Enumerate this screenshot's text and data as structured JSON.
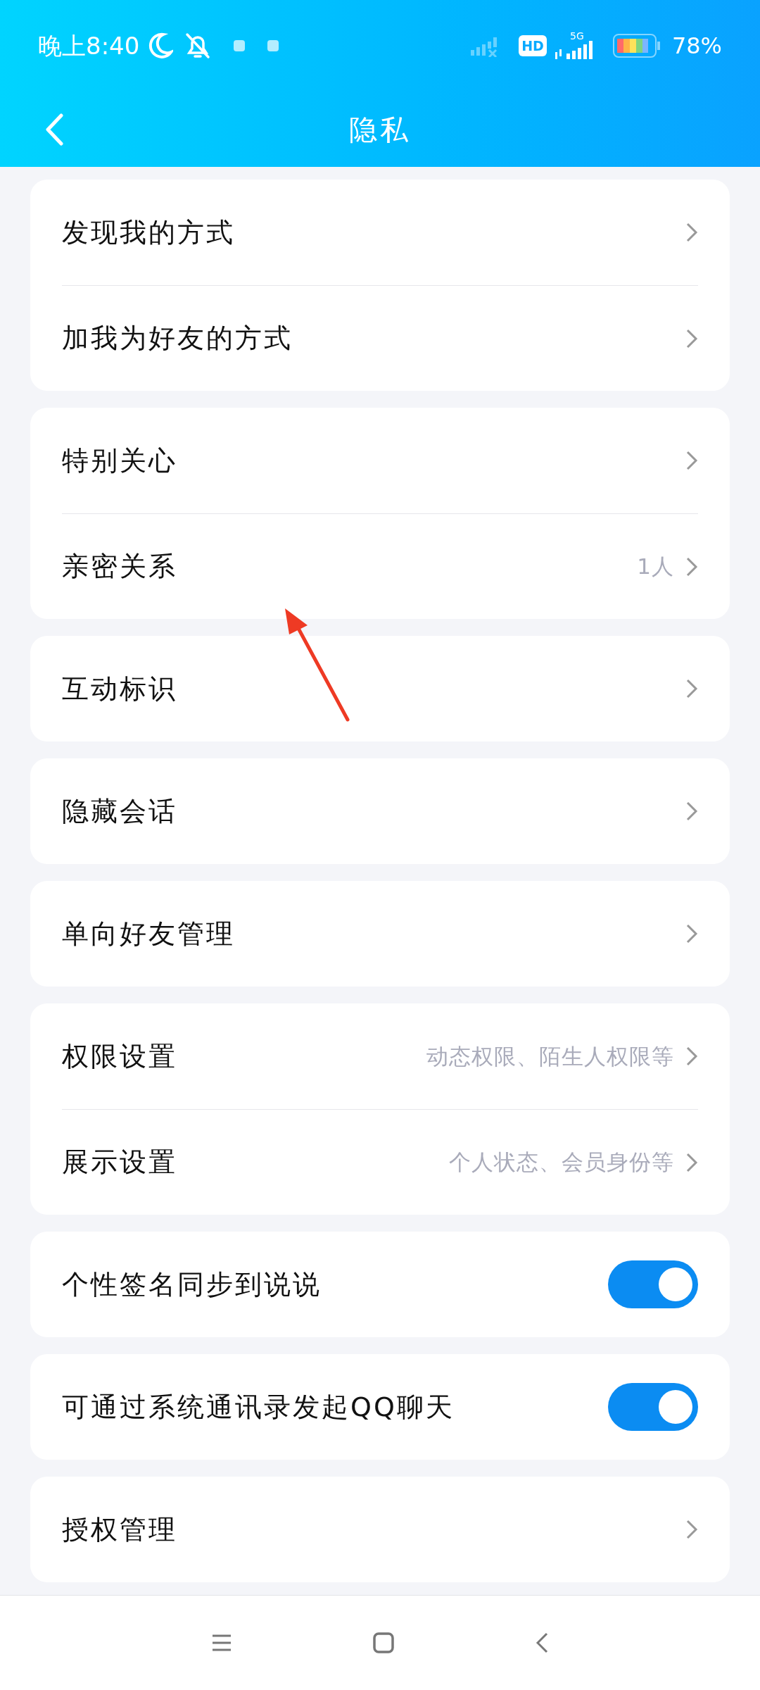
{
  "status_bar": {
    "time": "晚上8:40",
    "hd_badge": "HD",
    "network": "5G",
    "battery": "78%"
  },
  "header": {
    "title": "隐私"
  },
  "groups": [
    {
      "rows": [
        {
          "kind": "link",
          "label": "发现我的方式"
        },
        {
          "kind": "link",
          "label": "加我为好友的方式"
        }
      ]
    },
    {
      "rows": [
        {
          "kind": "link",
          "label": "特别关心"
        },
        {
          "kind": "link",
          "label": "亲密关系",
          "value": "1人"
        }
      ]
    },
    {
      "rows": [
        {
          "kind": "link",
          "label": "互动标识"
        }
      ]
    },
    {
      "rows": [
        {
          "kind": "link",
          "label": "隐藏会话"
        }
      ]
    },
    {
      "rows": [
        {
          "kind": "link",
          "label": "单向好友管理"
        }
      ]
    },
    {
      "rows": [
        {
          "kind": "link",
          "label": "权限设置",
          "value": "动态权限、陌生人权限等"
        },
        {
          "kind": "link",
          "label": "展示设置",
          "value": "个人状态、会员身份等"
        }
      ]
    },
    {
      "rows": [
        {
          "kind": "toggle",
          "label": "个性签名同步到说说",
          "on": true
        }
      ]
    },
    {
      "rows": [
        {
          "kind": "toggle",
          "label": "可通过系统通讯录发起QQ聊天",
          "on": true
        }
      ]
    },
    {
      "rows": [
        {
          "kind": "link",
          "label": "授权管理"
        }
      ]
    }
  ]
}
